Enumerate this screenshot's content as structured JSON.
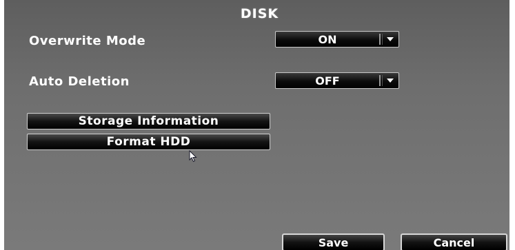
{
  "title": "DISK",
  "settings": {
    "overwrite_mode": {
      "label": "Overwrite Mode",
      "value": "ON"
    },
    "auto_deletion": {
      "label": "Auto Deletion",
      "value": "OFF"
    }
  },
  "actions": {
    "storage_information": "Storage Information",
    "format_hdd": "Format HDD"
  },
  "footer": {
    "save_label": "Save",
    "cancel_label": "Cancel"
  },
  "icons": {
    "dropdown_arrow": "chevron-down-icon",
    "pointer": "mouse-cursor-icon"
  },
  "colors": {
    "background": "#6e6e6e",
    "button_fill": "#000000",
    "text": "#ffffff"
  }
}
